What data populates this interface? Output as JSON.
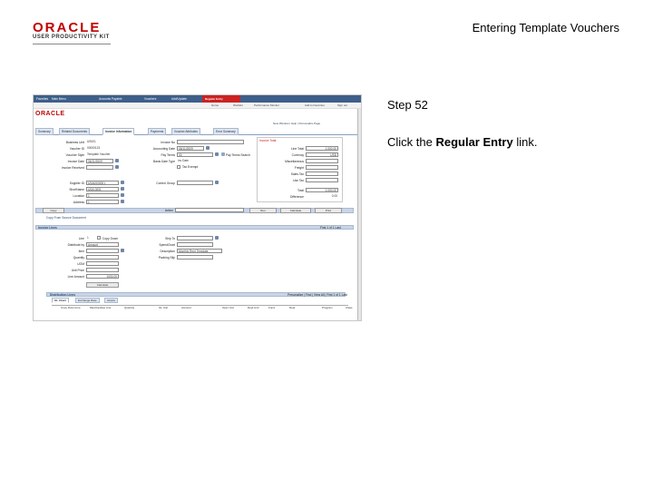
{
  "header": {
    "logo_text": "ORACLE",
    "logo_subtitle": "USER PRODUCTIVITY KIT",
    "deck_title": "Entering Template Vouchers"
  },
  "step": {
    "label": "Step 52"
  },
  "instruction": {
    "prefix": "Click the ",
    "target": "Regular Entry",
    "suffix": " link."
  },
  "screenshot": {
    "mini_logo": "ORACLE",
    "topbar": [
      "Favorites",
      "Main Menu",
      "Accounts Payable",
      "Vouchers",
      "Add/Update"
    ],
    "highlight_tab": "Regular Entry",
    "navbar": [
      "Home",
      "Worklist",
      "Performance Monitor",
      "Add to Favorites",
      "Sign out"
    ],
    "toolrow": "New Window | Help | Personalize Page",
    "tabs": [
      "Summary",
      "Related Documents",
      "Invoice Information",
      "Payments",
      "Voucher Attributes",
      "Error Summary"
    ],
    "left_fields": [
      {
        "label": "Business Unit",
        "value": "US001"
      },
      {
        "label": "Voucher ID",
        "value": "00000123"
      },
      {
        "label": "Voucher Style",
        "value": "Template Voucher"
      },
      {
        "label": "Invoice Date",
        "value": "06/11/2009"
      },
      {
        "label": "Invoice Received",
        "value": ""
      },
      {
        "label": "Supplier ID",
        "value": "USA0000001"
      },
      {
        "label": "ShortName",
        "value": "USA-0001"
      },
      {
        "label": "Location",
        "value": "1"
      },
      {
        "label": "Address",
        "value": "1"
      }
    ],
    "mid_fields": [
      {
        "label": "Invoice No",
        "value": ""
      },
      {
        "label": "Accounting Date",
        "value": "06/11/2009"
      },
      {
        "label": "Pay Terms",
        "value": "00"
      },
      {
        "label": "Basis Date Type",
        "value": "Inv Date"
      },
      {
        "label": "Control Group",
        "value": ""
      }
    ],
    "mid_extra": [
      "Tax Exempt",
      "Pay Terms Search"
    ],
    "summary_fields": [
      {
        "label": "Line Total",
        "value": "1,000.00"
      },
      {
        "label": "Currency",
        "value": "USD"
      },
      {
        "label": "Miscellaneous",
        "value": ""
      },
      {
        "label": "Freight",
        "value": ""
      },
      {
        "label": "Sales Tax",
        "value": ""
      },
      {
        "label": "Use Tax",
        "value": ""
      },
      {
        "label": "Total",
        "value": "1,000.00"
      },
      {
        "label": "Difference",
        "value": "0.00"
      }
    ],
    "summary_header": "Invoice Total",
    "action_band": {
      "left_btn": "Copy",
      "action_label": "Action",
      "buttons": [
        "Run",
        "Calculate",
        "Print"
      ]
    },
    "copy_link": "Copy From Source Document",
    "lines_title": "Invoice Lines",
    "lines_nav": "First 1 of 1 Last",
    "line_fields": [
      {
        "label": "Line",
        "value": "1"
      },
      {
        "label": "Distribute by",
        "value": "Amount"
      },
      {
        "label": "Item",
        "value": ""
      },
      {
        "label": "Quantity",
        "value": ""
      },
      {
        "label": "UOM",
        "value": ""
      },
      {
        "label": "Unit Price",
        "value": ""
      },
      {
        "label": "Line Amount",
        "value": "1000.00"
      }
    ],
    "line_right_fields": [
      {
        "label": "Ship To",
        "value": ""
      },
      {
        "label": "SpeedChart",
        "value": ""
      },
      {
        "label": "Description",
        "value": "Monthly Rent Template"
      },
      {
        "label": "Packing Slip",
        "value": ""
      }
    ],
    "copy_down": "Copy Down",
    "calc_btn": "Calculate",
    "dist_title": "Distribution Lines",
    "dist_nav": "Personalize | Find | View All | First 1 of 1 Last",
    "dist_tabs": [
      "GL Chart",
      "Exchange Rate",
      "Assets"
    ],
    "dist_columns": [
      "Copy Down",
      "Line",
      "Merchandise Amt",
      "Quantity",
      "GL Unit",
      "Account",
      "Oper Unit",
      "Dept Unit",
      "Fund",
      "Dept",
      "Program",
      "Class"
    ]
  }
}
